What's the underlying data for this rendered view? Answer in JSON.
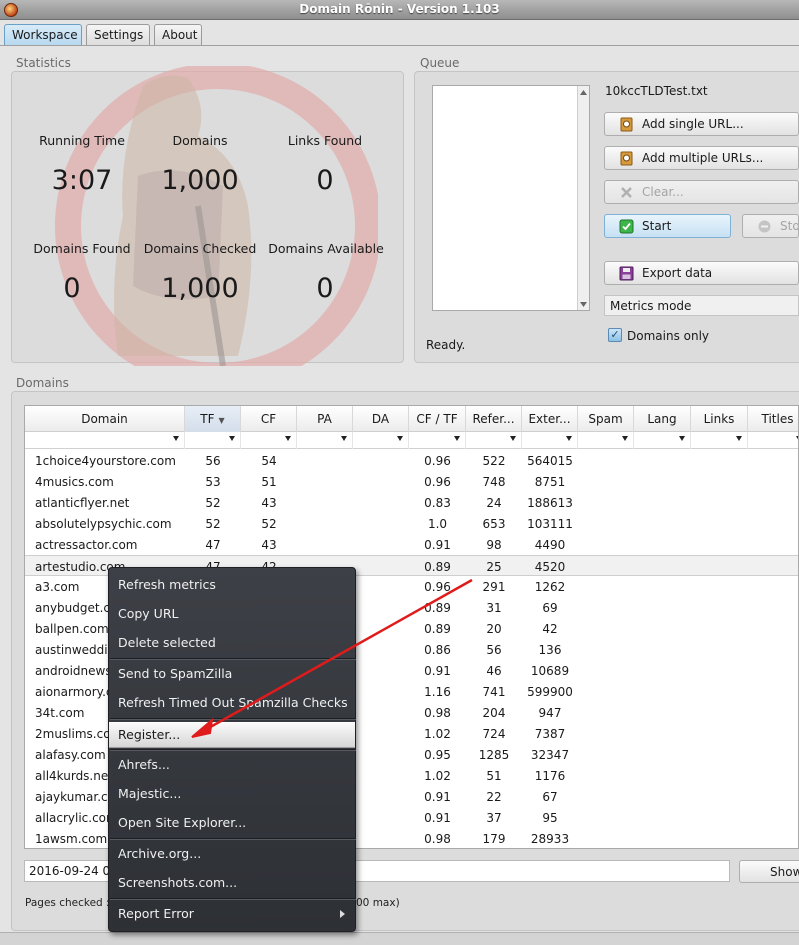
{
  "window": {
    "title": "Domain Rōnin - Version 1.103"
  },
  "tabs": [
    {
      "label": "Workspace"
    },
    {
      "label": "Settings"
    },
    {
      "label": "About"
    }
  ],
  "statistics": {
    "group_label": "Statistics",
    "running_time_label": "Running Time",
    "running_time": "3:07",
    "domains_label": "Domains",
    "domains": "1,000",
    "links_found_label": "Links Found",
    "links_found": "0",
    "domains_found_label": "Domains Found",
    "domains_found": "0",
    "domains_checked_label": "Domains Checked",
    "domains_checked": "1,000",
    "domains_available_label": "Domains Available",
    "domains_available": "0"
  },
  "queue": {
    "group_label": "Queue",
    "file_name": "10kccTLDTest.txt",
    "status": "Ready.",
    "add_single_label": "Add single URL...",
    "add_multiple_label": "Add multiple URLs...",
    "clear_label": "Clear...",
    "start_label": "Start",
    "stop_label": "Stop",
    "export_label": "Export data",
    "metrics_mode": "Metrics mode",
    "domains_only_label": "Domains only",
    "domains_only_checked": true
  },
  "domains": {
    "group_label": "Domains",
    "columns": [
      "Domain",
      "TF",
      "CF",
      "PA",
      "DA",
      "CF / TF",
      "Refer...",
      "Exter...",
      "Spam",
      "Lang",
      "Links",
      "Titles"
    ],
    "sorted_column_indicator": "▼",
    "rows": [
      {
        "domain": "1choice4yourstore.com",
        "tf": "56",
        "cf": "54",
        "cftf": "0.96",
        "ref": "522",
        "ext": "564015"
      },
      {
        "domain": "4musics.com",
        "tf": "53",
        "cf": "51",
        "cftf": "0.96",
        "ref": "748",
        "ext": "8751"
      },
      {
        "domain": "atlanticflyer.net",
        "tf": "52",
        "cf": "43",
        "cftf": "0.83",
        "ref": "24",
        "ext": "188613"
      },
      {
        "domain": "absolutelypsychic.com",
        "tf": "52",
        "cf": "52",
        "cftf": "1.0",
        "ref": "653",
        "ext": "103111"
      },
      {
        "domain": "actressactor.com",
        "tf": "47",
        "cf": "43",
        "cftf": "0.91",
        "ref": "98",
        "ext": "4490"
      },
      {
        "domain": "artestudio.com",
        "tf": "47",
        "cf": "42",
        "cftf": "0.89",
        "ref": "25",
        "ext": "4520"
      },
      {
        "domain": "a3.com",
        "tf": "",
        "cf": "",
        "cftf": "0.96",
        "ref": "291",
        "ext": "1262"
      },
      {
        "domain": "anybudget.co",
        "tf": "",
        "cf": "",
        "cftf": "0.89",
        "ref": "31",
        "ext": "69"
      },
      {
        "domain": "ballpen.com",
        "tf": "",
        "cf": "",
        "cftf": "0.89",
        "ref": "20",
        "ext": "42"
      },
      {
        "domain": "austinwedding",
        "tf": "",
        "cf": "",
        "cftf": "0.86",
        "ref": "56",
        "ext": "136"
      },
      {
        "domain": "androidnews2",
        "tf": "",
        "cf": "",
        "cftf": "0.91",
        "ref": "46",
        "ext": "10689"
      },
      {
        "domain": "aionarmory.co",
        "tf": "",
        "cf": "",
        "cftf": "1.16",
        "ref": "741",
        "ext": "599900"
      },
      {
        "domain": "34t.com",
        "tf": "",
        "cf": "",
        "cftf": "0.98",
        "ref": "204",
        "ext": "947"
      },
      {
        "domain": "2muslims.com",
        "tf": "",
        "cf": "",
        "cftf": "1.02",
        "ref": "724",
        "ext": "7387"
      },
      {
        "domain": "alafasy.com",
        "tf": "",
        "cf": "",
        "cftf": "0.95",
        "ref": "1285",
        "ext": "32347"
      },
      {
        "domain": "all4kurds.net",
        "tf": "",
        "cf": "",
        "cftf": "1.02",
        "ref": "51",
        "ext": "1176"
      },
      {
        "domain": "ajaykumar.co",
        "tf": "",
        "cf": "",
        "cftf": "0.91",
        "ref": "22",
        "ext": "67"
      },
      {
        "domain": "allacrylic.com",
        "tf": "",
        "cf": "",
        "cftf": "0.91",
        "ref": "37",
        "ext": "95"
      },
      {
        "domain": "1awsm.com",
        "tf": "",
        "cf": "",
        "cftf": "0.98",
        "ref": "179",
        "ext": "28933"
      }
    ]
  },
  "bottom": {
    "log_line": "2016-09-24 09:3",
    "show_label": "Show",
    "pages_checked": "Pages checked : 0",
    "status_tail": "00 max)"
  },
  "context_menu": {
    "items": [
      {
        "label": "Refresh metrics"
      },
      {
        "label": "Copy URL"
      },
      {
        "label": "Delete selected"
      },
      {
        "label": "Send to SpamZilla"
      },
      {
        "label": "Refresh Timed Out Spamzilla Checks"
      },
      {
        "label": "Register..."
      },
      {
        "label": "Ahrefs..."
      },
      {
        "label": "Majestic..."
      },
      {
        "label": "Open Site Explorer..."
      },
      {
        "label": "Archive.org..."
      },
      {
        "label": "Screenshots.com..."
      },
      {
        "label": "Report Error"
      }
    ]
  },
  "colors": {
    "annotation_arrow": "#e01b1b",
    "accent": "#b6d8f0",
    "menu_bg": "#2d3035"
  }
}
